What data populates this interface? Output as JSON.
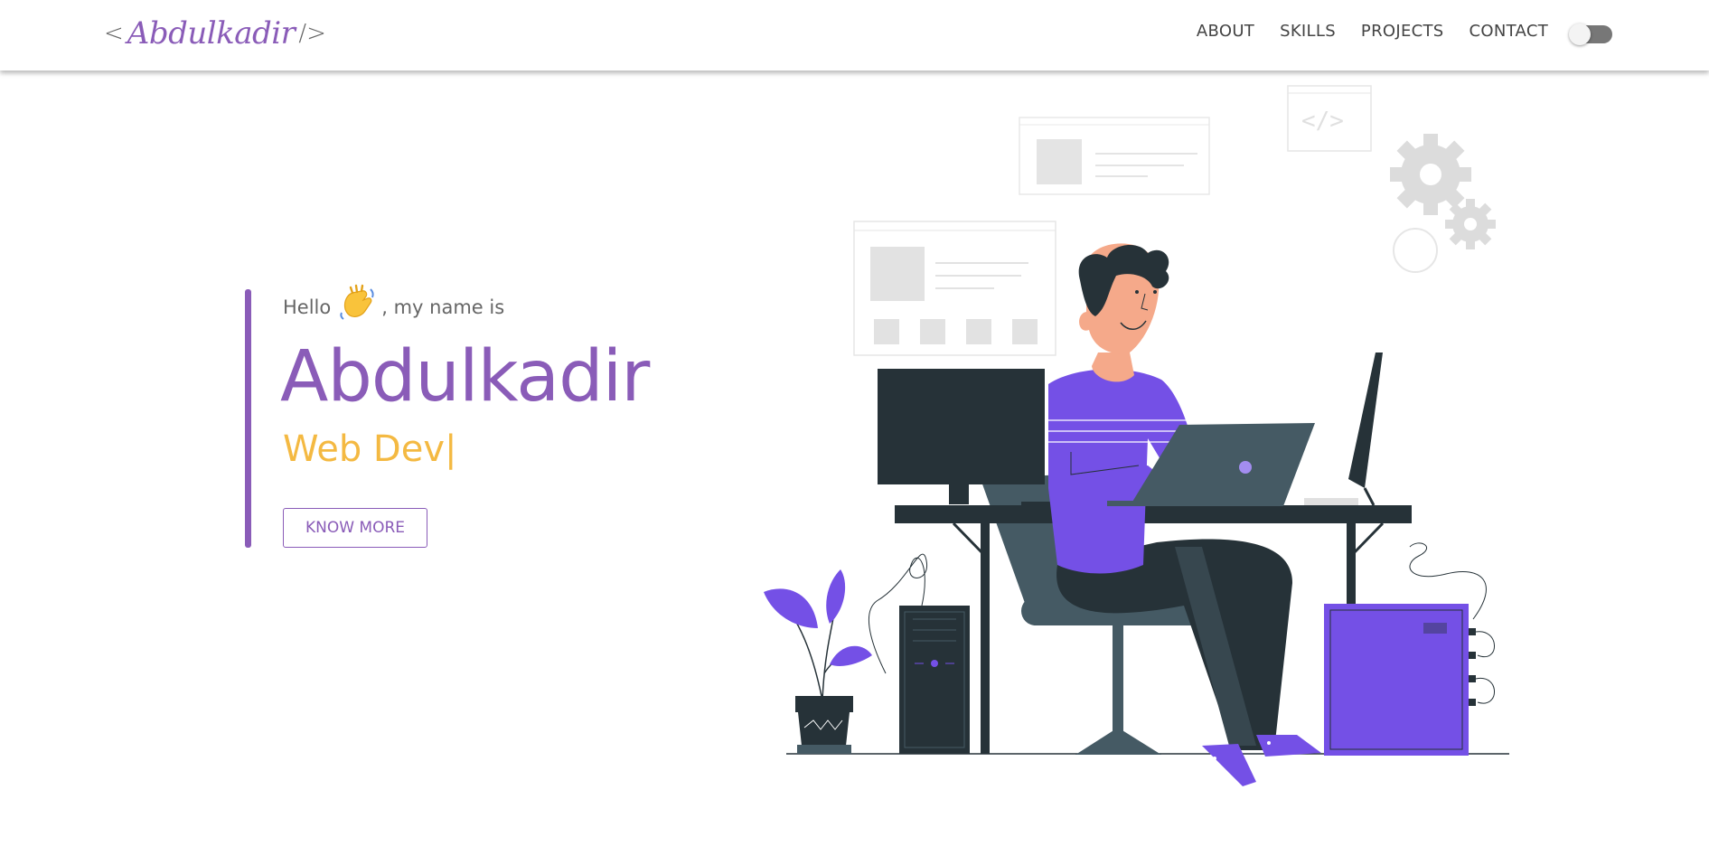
{
  "header": {
    "brand_open": "<",
    "brand_name": "Abdulkadir",
    "brand_close": "/>",
    "nav": [
      {
        "label": "ABOUT"
      },
      {
        "label": "SKILLS"
      },
      {
        "label": "PROJECTS"
      },
      {
        "label": "CONTACT"
      }
    ],
    "theme_toggle": {
      "state": "off"
    }
  },
  "hero": {
    "greeting_prefix": "Hello",
    "greeting_suffix": ", my name is",
    "name": "Abdulkadir",
    "role": "Web Dev",
    "cursor": "|",
    "cta_label": "KNOW MORE"
  },
  "colors": {
    "accent": "#8a5cb8",
    "highlight": "#f4b942",
    "illustration_purple": "#7450e6",
    "illustration_dark": "#263238"
  },
  "icons": [
    "waving-hand-icon",
    "gear-icon"
  ]
}
